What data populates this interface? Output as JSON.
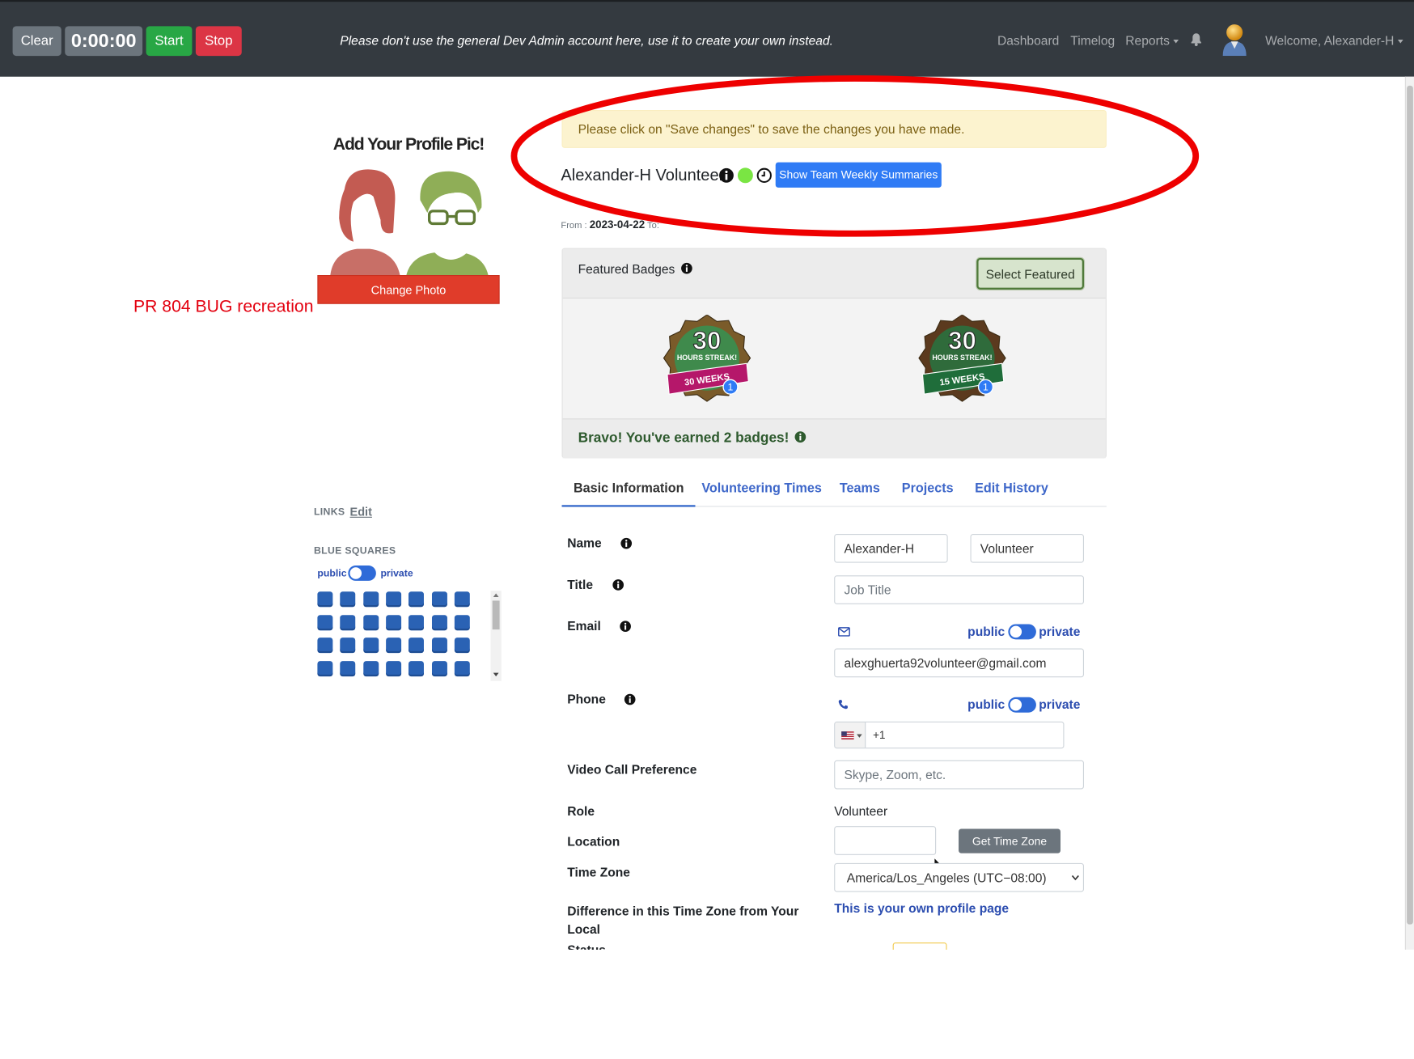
{
  "navbar": {
    "clear_label": "Clear",
    "timer": "0:00:00",
    "start_label": "Start",
    "stop_label": "Stop",
    "message": "Please don't use the general Dev Admin account here, use it to create your own instead.",
    "links": [
      "Dashboard",
      "Timelog",
      "Reports"
    ],
    "welcome": "Welcome, Alexander-H"
  },
  "left": {
    "pic_title": "Add Your Profile Pic!",
    "change_photo": "Change Photo",
    "bug_note": "PR 804 BUG recreation",
    "links_label": "LINKS",
    "links_edit": "Edit",
    "blue_squares_label": "BLUE SQUARES",
    "public": "public",
    "private": "private"
  },
  "alert": "Please click on \"Save changes\" to save the changes you have made.",
  "profile": {
    "name": "Alexander-H Volunteer",
    "summaries_button": "Show Team Weekly Summaries",
    "from_label": "From :",
    "from_date": "2023-04-22",
    "to_label": "To:"
  },
  "badges": {
    "title": "Featured Badges",
    "select_button": "Select Featured",
    "bravo": "Bravo! You've earned 2 badges!",
    "items": [
      {
        "number": "30",
        "line1": "HOURS STREAK!",
        "line2": "30 WEEKS",
        "count": "1",
        "color": "#b5176a"
      },
      {
        "number": "30",
        "line1": "HOURS STREAK!",
        "line2": "15 WEEKS",
        "count": "1",
        "color": "#1f6d3a"
      }
    ]
  },
  "tabs": [
    "Basic Information",
    "Volunteering Times",
    "Teams",
    "Projects",
    "Edit History"
  ],
  "form": {
    "name_label": "Name",
    "first_name": "Alexander-H",
    "last_name": "Volunteer",
    "title_label": "Title",
    "title_placeholder": "Job Title",
    "email_label": "Email",
    "email": "alexghuerta92volunteer@gmail.com",
    "phone_label": "Phone",
    "phone_code": "+1",
    "video_label": "Video Call Preference",
    "video_placeholder": "Skype, Zoom, etc.",
    "role_label": "Role",
    "role": "Volunteer",
    "location_label": "Location",
    "tz_button": "Get Time Zone",
    "timezone_label": "Time Zone",
    "timezone": "America/Los_Angeles (UTC−08:00)",
    "diff_label": "Difference in this Time Zone from Your Local",
    "own_profile": "This is your own profile page",
    "status_label": "Status",
    "public": "public",
    "private": "private"
  },
  "colors": {
    "navbar": "#343a40",
    "accent": "#2f7bf5",
    "danger": "#dc3545",
    "success": "#28a745",
    "annotation": "#e3000f"
  }
}
